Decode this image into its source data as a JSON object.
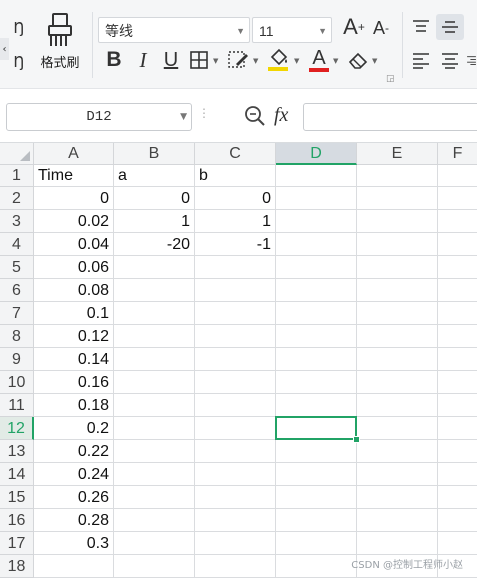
{
  "ribbon": {
    "format_painter_label": "格式刷",
    "clipboard_partial_label_top": "Ŋ",
    "clipboard_partial_label_bottom": "Ŋ",
    "font_name": "等线",
    "font_size": "11",
    "bold_label": "B",
    "italic_label": "I",
    "underline_label": "U",
    "font_color_label": "A",
    "grow_font_label": "A",
    "shrink_font_label": "A",
    "grow_sup": "+",
    "shrink_sup": "-",
    "font_color": "#e02020",
    "fill_color": "#f2d600"
  },
  "formula_bar": {
    "name_box": "D12",
    "fx_label": "fx",
    "formula": ""
  },
  "sheet": {
    "columns": [
      "A",
      "B",
      "C",
      "D",
      "E",
      "F"
    ],
    "selected_column": "D",
    "selected_row": "12",
    "rows": [
      {
        "n": "1",
        "a": "Time",
        "b": "a",
        "c": "b"
      },
      {
        "n": "2",
        "a": "0",
        "b": "0",
        "c": "0"
      },
      {
        "n": "3",
        "a": "0.02",
        "b": "1",
        "c": "1"
      },
      {
        "n": "4",
        "a": "0.04",
        "b": "-20",
        "c": "-1"
      },
      {
        "n": "5",
        "a": "0.06",
        "b": "",
        "c": ""
      },
      {
        "n": "6",
        "a": "0.08",
        "b": "",
        "c": ""
      },
      {
        "n": "7",
        "a": "0.1",
        "b": "",
        "c": ""
      },
      {
        "n": "8",
        "a": "0.12",
        "b": "",
        "c": ""
      },
      {
        "n": "9",
        "a": "0.14",
        "b": "",
        "c": ""
      },
      {
        "n": "10",
        "a": "0.16",
        "b": "",
        "c": ""
      },
      {
        "n": "11",
        "a": "0.18",
        "b": "",
        "c": ""
      },
      {
        "n": "12",
        "a": "0.2",
        "b": "",
        "c": ""
      },
      {
        "n": "13",
        "a": "0.22",
        "b": "",
        "c": ""
      },
      {
        "n": "14",
        "a": "0.24",
        "b": "",
        "c": ""
      },
      {
        "n": "15",
        "a": "0.26",
        "b": "",
        "c": ""
      },
      {
        "n": "16",
        "a": "0.28",
        "b": "",
        "c": ""
      },
      {
        "n": "17",
        "a": "0.3",
        "b": "",
        "c": ""
      },
      {
        "n": "18",
        "a": "",
        "b": "",
        "c": ""
      }
    ]
  },
  "accent_color": "#21a366",
  "watermark": "CSDN @控制工程师小赵"
}
